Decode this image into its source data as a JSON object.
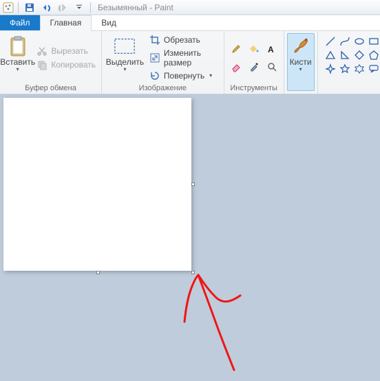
{
  "title": {
    "doc": "Безымянный",
    "app": "Paint"
  },
  "tabs": {
    "file": "Файл",
    "home": "Главная",
    "view": "Вид"
  },
  "groups": {
    "clipboard": {
      "label": "Буфер обмена",
      "paste": "Вставить",
      "cut": "Вырезать",
      "copy": "Копировать"
    },
    "image": {
      "label": "Изображение",
      "select": "Выделить",
      "crop": "Обрезать",
      "resize": "Изменить размер",
      "rotate": "Повернуть"
    },
    "tools": {
      "label": "Инструменты"
    },
    "brushes": {
      "label": "Кисти"
    }
  },
  "colors": {
    "accent": "#1979ca",
    "shape_blue": "#2a5db0",
    "brush_orange": "#e08a2f",
    "red_stroke": "#f01616"
  }
}
